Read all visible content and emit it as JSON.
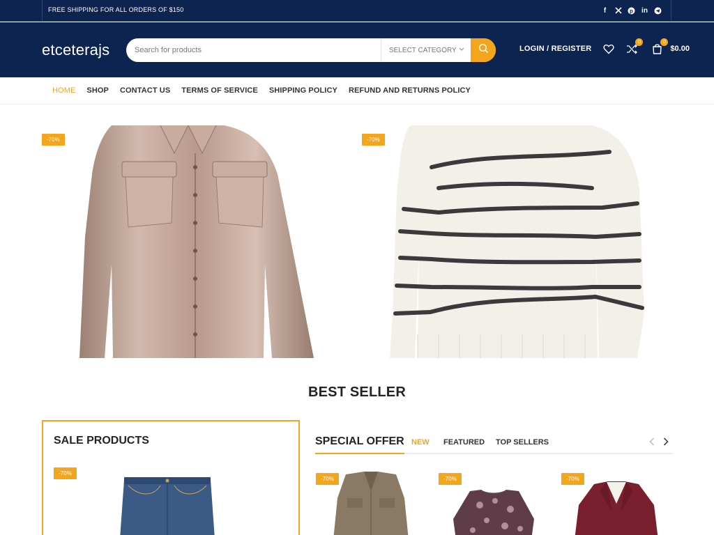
{
  "topbar": {
    "shipping_text": "FREE SHIPPING FOR ALL ORDERS OF $150",
    "socials": [
      "facebook-icon",
      "x-twitter-icon",
      "pinterest-icon",
      "linkedin-icon",
      "telegram-icon"
    ]
  },
  "header": {
    "logo": "etceterajs",
    "search_placeholder": "Search for products",
    "category_label": "SELECT CATEGORY",
    "login_label": "LOGIN / REGISTER",
    "compare_count": "0",
    "cart_count": "0",
    "cart_total": "$0.00"
  },
  "nav": {
    "items": [
      {
        "label": "HOME",
        "active": true
      },
      {
        "label": "SHOP"
      },
      {
        "label": "CONTACT US"
      },
      {
        "label": "TERMS OF SERVICE"
      },
      {
        "label": "SHIPPING POLICY"
      },
      {
        "label": "REFUND AND RETURNS POLICY"
      }
    ]
  },
  "banners": [
    {
      "badge": "-70%",
      "product": "satin-shirt-image"
    },
    {
      "badge": "-70%",
      "product": "striped-sweater-image"
    }
  ],
  "best_seller": {
    "title": "BEST SELLER",
    "sale_products_title": "SALE PRODUCTS",
    "sale_badge": "-70%",
    "special_offer": "SPECIAL OFFER",
    "tabs": [
      "NEW",
      "FEATURED",
      "TOP SELLERS"
    ],
    "product_badges": [
      "-70%",
      "-70%",
      "-70%"
    ]
  },
  "colors": {
    "navy": "#0e2450",
    "accent": "#f4a51c"
  }
}
